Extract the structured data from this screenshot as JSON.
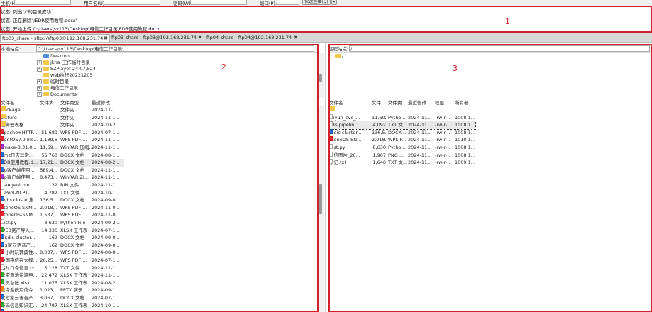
{
  "quickconnect": {
    "host_label": "主机(H):",
    "user_label": "用户名(U):",
    "pass_label": "密码(W):",
    "port_label": "端口(P):",
    "connect_button": "快速连接(Q)",
    "dropdown_icon": "chevron-down-icon"
  },
  "log": {
    "lines": [
      "状态: 列出\"/\"的目录成功",
      "状态: 正在删除\"/EDR使用教程.docx\"",
      "状态: 开始上传 C:\\Users\\sy113\\Desktop\\电信工作目录\\EDR使用教程.docx"
    ]
  },
  "tabs": [
    {
      "label": "ftp03_share - sftp://sftp03@192.168.231.74",
      "close": "✖"
    },
    {
      "label": "ftp03_share - ftp03@192.168.231.74",
      "close": "✖"
    },
    {
      "label": "ftp04_share - ftp04@192.168.231.74",
      "close": "✖"
    }
  ],
  "local": {
    "site_label": "本地站点:",
    "path": "C:\\Users\\sy113\\Desktop\\电信工作目录\\",
    "tree": [
      {
        "label": "Desktop",
        "expander": "",
        "icon": "desktop-folder-icon"
      },
      {
        "label": "jkha_工作临时目录",
        "expander": "+",
        "icon": "folder-icon"
      },
      {
        "label": "SZPlayer 24.07.524",
        "expander": "+",
        "icon": "folder-icon"
      },
      {
        "label": "web执行20221205",
        "expander": "",
        "icon": "folder-icon"
      },
      {
        "label": "临时目录",
        "expander": "+",
        "icon": "folder-icon"
      },
      {
        "label": "电信工作目录",
        "expander": "+",
        "icon": "folder-icon"
      },
      {
        "label": "Documents",
        "expander": "+",
        "icon": "folder-icon"
      }
    ],
    "columns": [
      "文件名",
      "文件大...",
      "文件类型",
      "最近修改"
    ],
    "files": [
      {
        "name": "package",
        "size": "",
        "type": "文件夹",
        "modified": "2024-11-1...",
        "icon": "folder"
      },
      {
        "name": "picture",
        "size": "",
        "type": "文件夹",
        "modified": "2024-11-1...",
        "icon": "folder"
      },
      {
        "name": "服务器表格",
        "size": "",
        "type": "文件夹",
        "modified": "2024-10-2...",
        "icon": "folder"
      },
      {
        "name": "Apache+HTTP...",
        "size": "51,689",
        "type": "WPS PDF ...",
        "modified": "2024-07-1...",
        "icon": "red"
      },
      {
        "name": "CentOS7.9 Ins...",
        "size": "1,189,6...",
        "type": "WPS PDF ...",
        "modified": "2024-11-1...",
        "icon": "red"
      },
      {
        "name": "cmake-3.31.0...",
        "size": "11,69...",
        "type": "WinRAR 压缩...",
        "modified": "2024-11-1...",
        "icon": "purple"
      },
      {
        "name": "dmz日志异常...",
        "size": "56,760",
        "type": "DOCX 文档",
        "modified": "2024-08-1...",
        "icon": "blue"
      },
      {
        "name": "EDR使用教程.d...",
        "size": "17,21...",
        "type": "DOCX 文档",
        "modified": "2024-08-2...",
        "icon": "blue"
      },
      {
        "name": "ftp客户端使用...",
        "size": "589,4...",
        "type": "DOCX 文档",
        "modified": "2024-11-1...",
        "icon": "blue"
      },
      {
        "name": "ftp客户端使用...",
        "size": "8,473,...",
        "type": "WinRAR ZI...",
        "modified": "2024-11-1...",
        "icon": "purple"
      },
      {
        "name": "IsaAgent.bin",
        "size": "132",
        "type": "BIN 文件",
        "modified": "2024-11-1...",
        "icon": "plain"
      },
      {
        "name": "JSPool-NLPT-...",
        "size": "4,782",
        "type": "TXT 文件",
        "modified": "2024-10-1...",
        "icon": "plain"
      },
      {
        "name": "redis cluster集...",
        "size": "136,5...",
        "type": "DOCX 文档",
        "modified": "2024-09-0...",
        "icon": "blue"
      },
      {
        "name": "StoneOS SNM...",
        "size": "2,018,...",
        "type": "WPS PDF ...",
        "modified": "2024-11-0...",
        "icon": "red"
      },
      {
        "name": "StoneOS-SNM...",
        "size": "1,537,...",
        "type": "WPS PDF ...",
        "modified": "2024-11-0...",
        "icon": "red"
      },
      {
        "name": "test.py",
        "size": "8,630",
        "type": "Python File",
        "modified": "2024-09-2...",
        "icon": "plain"
      },
      {
        "name": "WEB资产导入...",
        "size": "14,336",
        "type": "XLSX 工作表",
        "modified": "2024-07-1...",
        "icon": "green"
      },
      {
        "name": "~$dis cluster...",
        "size": "162",
        "type": "DOCX 文档",
        "modified": "2024-09-0...",
        "icon": "blue"
      },
      {
        "name": "~$家云语音产...",
        "size": "162",
        "type": "DOCX 文档",
        "modified": "2024-09-0...",
        "icon": "blue"
      },
      {
        "name": "一小时玩转典性...",
        "size": "8,037,...",
        "type": "WPS PDF ...",
        "modified": "2024-08-0...",
        "icon": "red"
      },
      {
        "name": "中国电信在大模...",
        "size": "26,25...",
        "type": "WPS PDF ...",
        "modified": "2024-07-1...",
        "icon": "red"
      },
      {
        "name": "临时口令信息.txt",
        "size": "5,128",
        "type": "TXT 文件",
        "modified": "2024-11-1...",
        "icon": "plain"
      },
      {
        "name": "云资源池资源申...",
        "size": "22,472",
        "type": "XLSX 工作表",
        "modified": "2024-11-1...",
        "icon": "green"
      },
      {
        "name": "人员台账.xlsx",
        "size": "11,075",
        "type": "XLSX 工作表",
        "modified": "2024-08-2...",
        "icon": "green"
      },
      {
        "name": "信令系统及信令...",
        "size": "1,023,...",
        "type": "PPTX 演示...",
        "modified": "2024-09-1...",
        "icon": "orange"
      },
      {
        "name": "北七家云语音产...",
        "size": "3,067,...",
        "type": "DOCX 文档",
        "modified": "2024-07-1...",
        "icon": "blue"
      },
      {
        "name": "号码信息知识汇...",
        "size": "24,797",
        "type": "XLSX 工作表",
        "modified": "2024-10-1...",
        "icon": "green"
      },
      {
        "name": "员工信息表-XX...",
        "size": "1,377,...",
        "type": "DOCX 文档",
        "modified": "2024-10-1...",
        "icon": "blue"
      }
    ]
  },
  "remote": {
    "site_label": "远程站点:",
    "path": "/",
    "tree": [
      {
        "label": "/",
        "icon": "folder-icon"
      }
    ],
    "columns": [
      "文件名",
      "文件...",
      "文件类...",
      "最近修改",
      "权限",
      "所有者..."
    ],
    "files": [
      {
        "name": "..",
        "size": "",
        "type": "",
        "modified": "",
        "perm": "",
        "owner": "",
        "icon": "folder"
      },
      {
        "name": "aliyun_cve_...",
        "size": "11,602",
        "type": "Pytho...",
        "modified": "2024-11...",
        "perm": "-rw-r-...",
        "owner": "1008 1...",
        "icon": "plain"
      },
      {
        "name": "k8s-pipelin...",
        "size": "4,092",
        "type": "TXT 文...",
        "modified": "2024-11...",
        "perm": "-rw-r-...",
        "owner": "1008 1...",
        "icon": "plain"
      },
      {
        "name": "redis cluster...",
        "size": "136,5...",
        "type": "DOCX ...",
        "modified": "2024-11...",
        "perm": "-rw-r-...",
        "owner": "1008 1...",
        "icon": "blue"
      },
      {
        "name": "StoneOS SN...",
        "size": "2,018...",
        "type": "WPS P...",
        "modified": "2024-11...",
        "perm": "-rw-r-...",
        "owner": "1010 1...",
        "icon": "red"
      },
      {
        "name": "test.py",
        "size": "8,630",
        "type": "Pytho...",
        "modified": "2024-11...",
        "perm": "-rw-r-...",
        "owner": "1008 1...",
        "icon": "plain"
      },
      {
        "name": "微信图片_20...",
        "size": "1,907",
        "type": "PNG ...",
        "modified": "2024-11...",
        "perm": "-rw-r-...",
        "owner": "1008 1...",
        "icon": "plain"
      },
      {
        "name": "手记.txt",
        "size": "1,640",
        "type": "TXT 文...",
        "modified": "2024-11...",
        "perm": "-rw-r-...",
        "owner": "1009 1...",
        "icon": "plain"
      }
    ]
  },
  "annotations": [
    "1",
    "2",
    "3"
  ],
  "colors": {
    "annotation": "#d0202a",
    "folder": "#f1c84b"
  }
}
